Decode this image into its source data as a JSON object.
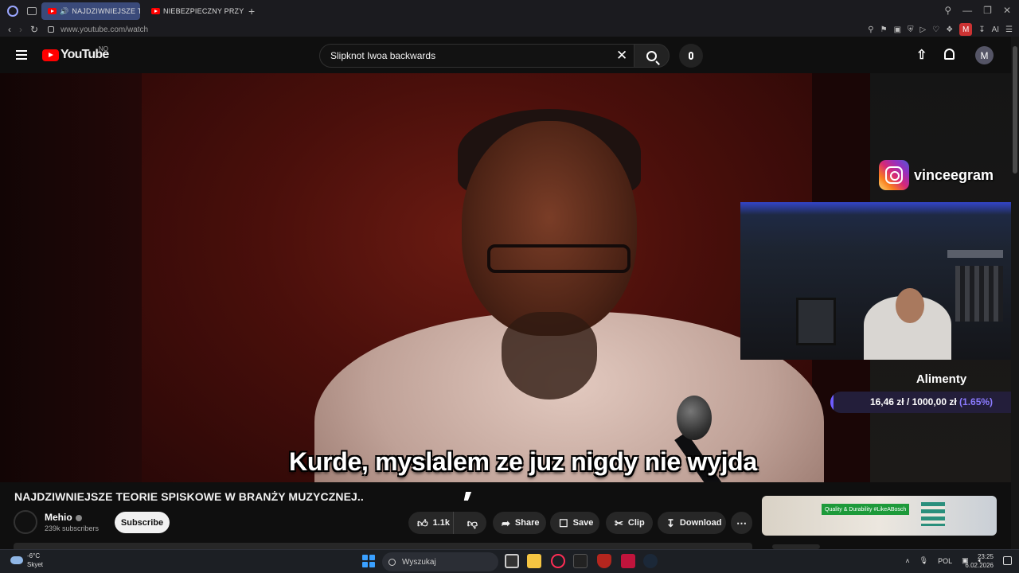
{
  "browser": {
    "tabs": [
      {
        "title": "NAJDZIWNIEJSZE TEC",
        "active": true,
        "audio": true
      },
      {
        "title": "NIEBEZPIECZNY PRZYPAD",
        "active": false,
        "audio": false
      }
    ],
    "new_tab_label": "+",
    "url": "www.youtube.com/watch",
    "ab_badge": "M",
    "ai_label": "AI"
  },
  "yt_header": {
    "logo_text": "YouTube",
    "region": "NO",
    "search_value": "Slipknot Iwoa backwards",
    "avatar_letter": "M"
  },
  "video": {
    "subtitle": "Kurde, myslalem ze juz nigdy nie wyjda",
    "overlay": {
      "instagram_handle": "vinceegram",
      "goal_title": "Alimenty",
      "goal_amount": "16,46 zł / 1000,00 zł",
      "goal_percent": "(1.65%)",
      "goal_fraction": 0.0165
    }
  },
  "below": {
    "title": "NAJDZIWNIEJSZE TEORIE SPISKOWE W BRANŻY MUZYCZNEJ..",
    "channel_name": "Mehio",
    "subscribers": "239k subscribers",
    "subscribe_label": "Subscribe",
    "like_count": "1.1k",
    "share_label": "Share",
    "save_label": "Save",
    "clip_label": "Clip",
    "download_label": "Download",
    "ad_text": "Quality & Durability #LikeABosch"
  },
  "taskbar": {
    "weather_temp": "-6°C",
    "weather_desc": "Skyet",
    "search_placeholder": "Wyszukaj",
    "lang": "POL",
    "time": "23:25",
    "date": "6.02.2026"
  },
  "colors": {
    "yt_red": "#ff0000",
    "goal_fill": "#6e5cff",
    "goal_percent": "#8b7bff",
    "active_tab": "#3a4a7a",
    "ad_green": "#1d9a3a"
  }
}
